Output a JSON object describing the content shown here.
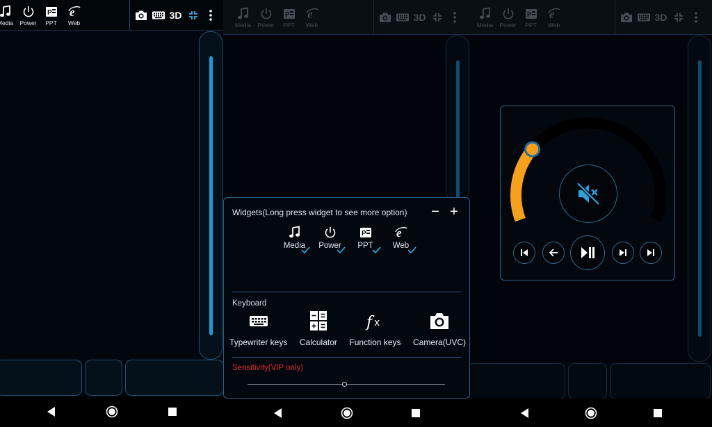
{
  "topbar": {
    "widgets": [
      {
        "label": "Media",
        "icon": "music-note-icon"
      },
      {
        "label": "Power",
        "icon": "power-icon"
      },
      {
        "label": "PPT",
        "icon": "ppt-icon"
      },
      {
        "label": "Web",
        "icon": "web-browser-icon"
      }
    ],
    "right_icons": [
      "camera-icon",
      "keyboard-icon",
      "3d-text",
      "collapse-icon",
      "more-vert-icon"
    ],
    "label_3d": "3D"
  },
  "widgets_sheet": {
    "title": "Widgets(Long press widget to see more option)",
    "minus": "−",
    "plus": "+",
    "widgets": [
      {
        "label": "Media",
        "checked": true
      },
      {
        "label": "Power",
        "checked": true
      },
      {
        "label": "PPT",
        "checked": true
      },
      {
        "label": "Web",
        "checked": true
      }
    ],
    "keyboard_title": "Keyboard",
    "keyboard_tools": [
      {
        "label": "Typewriter keys",
        "icon": "keyboard-icon"
      },
      {
        "label": "Calculator",
        "icon": "calculator-icon"
      },
      {
        "label": "Function keys",
        "icon": "function-fx-icon"
      },
      {
        "label": "Camera(UVC)",
        "icon": "camera-icon"
      }
    ],
    "sensitivity_label": "Sensitivity(VIP only)",
    "sensitivity_value": 0.49
  },
  "media_widget": {
    "volume_level": 0.27,
    "muted": true,
    "controls": [
      "previous-track",
      "back",
      "play-pause",
      "next-frame",
      "next-track"
    ]
  },
  "colors": {
    "accent_blue": "#1a9ad6",
    "border_blue": "#2b5f85",
    "volume_orange": "#f7a11a",
    "sensitivity_red": "#e02a2a",
    "background": "#02070d"
  },
  "navbar": [
    "back-triangle-icon",
    "home-circle-icon",
    "recents-square-icon"
  ]
}
